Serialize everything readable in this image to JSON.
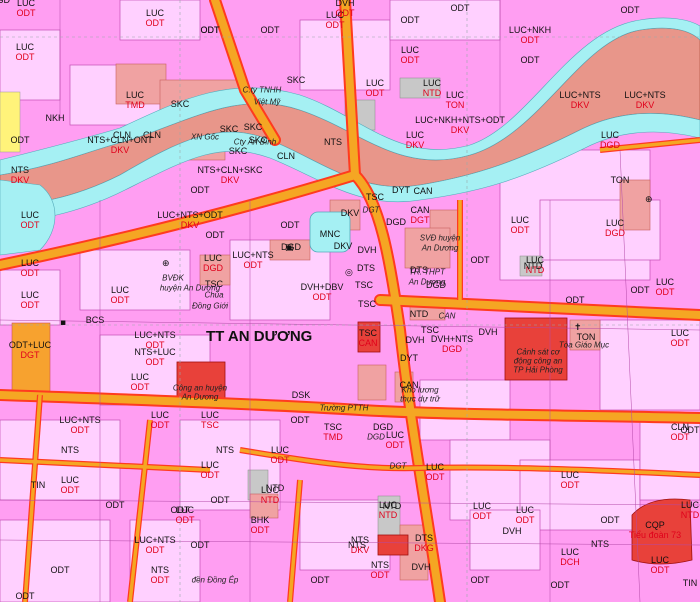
{
  "title": "TT AN DƯƠNG",
  "colors": {
    "residential": "#ff9ef2",
    "agriculture_rice": "#ffd0ff",
    "river": "#e8968a",
    "water": "#a5f0f3",
    "road": "#f5a623",
    "road_edge": "#ff3b1f",
    "public": "#f0a2a2",
    "school": "#f4b39b",
    "police": "#e8413a",
    "yellow": "#fff37a",
    "grey": "#c8c8c8"
  },
  "labels": [
    {
      "code": "LUC",
      "use": "ODT"
    },
    {
      "code": "LUC",
      "use": "ODT"
    },
    {
      "code": "LUC",
      "use": "TMD"
    },
    {
      "code": "ODT",
      "use": ""
    },
    {
      "code": "LUC",
      "use": "ODT"
    },
    {
      "code": "LUC",
      "use": "ODT"
    },
    {
      "code": "DVH",
      "use": "ODT"
    },
    {
      "code": "LUC",
      "use": "ODT"
    },
    {
      "code": "LUC+NKH",
      "use": "ODT"
    },
    {
      "code": "LUC",
      "use": "ODT"
    },
    {
      "code": "LUC",
      "use": "NTD"
    },
    {
      "code": "LUC",
      "use": "TON"
    },
    {
      "code": "LUC+NTS",
      "use": "DKV"
    },
    {
      "code": "LUC+NTS",
      "use": "DKV"
    },
    {
      "code": "LUC+NKH+NTS+ODT",
      "use": "DKV"
    },
    {
      "code": "LUC",
      "use": "DKV"
    },
    {
      "code": "NTS",
      "use": "DKV"
    },
    {
      "code": "NTS+CLN+ONT",
      "use": "DKV"
    },
    {
      "code": "NTS+CLN+SKC",
      "use": "DKV"
    },
    {
      "code": "LUC+NTS+ODT",
      "use": "DKV"
    },
    {
      "code": "LUC",
      "use": "ODT"
    },
    {
      "code": "LUC",
      "use": "ODT"
    },
    {
      "code": "LUC",
      "use": "DGD"
    },
    {
      "code": "LUC+NTS",
      "use": "ODT"
    },
    {
      "code": "DVH+DBV",
      "use": "ODT"
    },
    {
      "code": "LUC",
      "use": "ODT"
    },
    {
      "code": "LUC",
      "use": "ODT"
    },
    {
      "code": "LUC",
      "use": "ODT"
    },
    {
      "code": "LUC",
      "use": "NTD"
    },
    {
      "code": "LUC",
      "use": "DGD"
    },
    {
      "code": "LUC",
      "use": "ODT"
    },
    {
      "code": "LUC",
      "use": "ODT"
    },
    {
      "code": "ODT+LUC",
      "use": "DGT"
    },
    {
      "code": "LUC+NTS",
      "use": "ODT"
    },
    {
      "code": "NTS+LUC",
      "use": "ODT"
    },
    {
      "code": "LUC",
      "use": "ODT"
    },
    {
      "code": "DVH+NTS",
      "use": "DGD"
    },
    {
      "code": "LUC",
      "use": "ODT"
    },
    {
      "code": "LUC+NTS",
      "use": "ODT"
    },
    {
      "code": "LUC",
      "use": "TSC"
    },
    {
      "code": "LUC",
      "use": "ODT"
    },
    {
      "code": "LUC",
      "use": "ODT"
    },
    {
      "code": "LUC",
      "use": "ODT"
    },
    {
      "code": "CLN",
      "use": "ODT"
    },
    {
      "code": "LUC",
      "use": "ODT"
    },
    {
      "code": "LUC",
      "use": "ODT"
    },
    {
      "code": "LUC",
      "use": "ODT"
    },
    {
      "code": "LUC",
      "use": "NTD"
    },
    {
      "code": "LUC",
      "use": "DCH"
    },
    {
      "code": "LUC",
      "use": "ODT"
    },
    {
      "code": "LUC",
      "use": "ODT"
    },
    {
      "code": "LUC+NTS",
      "use": "ODT"
    },
    {
      "code": "NTS",
      "use": "ODT"
    },
    {
      "code": "NTS",
      "use": "ODT"
    },
    {
      "code": "NTS",
      "use": "DKV"
    },
    {
      "code": "LUC",
      "use": "ODT"
    },
    {
      "code": "BHK",
      "use": "ODT"
    },
    {
      "code": "LUC",
      "use": "ODT"
    },
    {
      "code": "TSC",
      "use": "TMD"
    },
    {
      "code": "CQP",
      "use": "Tiểu đoàn 73"
    },
    {
      "code": "CAN",
      "use": "DGT"
    },
    {
      "code": "TSC",
      "use": "CAN"
    },
    {
      "code": "LUC",
      "use": "NTD"
    },
    {
      "code": "LUC",
      "use": "NTD"
    },
    {
      "code": "DTS",
      "use": "DKG"
    },
    {
      "code": "LUC",
      "use": "DGD"
    }
  ],
  "codes": [
    "ODT",
    "ODT",
    "ODT",
    "ODT",
    "ODT",
    "ODT",
    "ODT",
    "ODT",
    "ODT",
    "ODT",
    "ODT",
    "ODT",
    "ODT",
    "ODT",
    "ODT",
    "ODT",
    "ODT",
    "ODT",
    "ODT",
    "ODT",
    "ODT",
    "ODT",
    "ODT",
    "ODT",
    "ODT",
    "NKH",
    "NTS",
    "NTS",
    "NTS",
    "SKC",
    "SKC",
    "SKC",
    "SKC",
    "SKC",
    "SKC",
    "CLN",
    "CLN",
    "CLN",
    "MNC",
    "DKV",
    "DKV",
    "DVH",
    "DTS",
    "DTS",
    "DYT",
    "DYT",
    "TSC",
    "TSC",
    "TSC",
    "TSC",
    "TSC",
    "TON",
    "TON",
    "NTD",
    "NTD",
    "NTD",
    "NTD",
    "DGD",
    "DGD",
    "DGD",
    "DGD",
    "DVH",
    "DVH",
    "CAN",
    "CAN",
    "DSK",
    "BCS",
    "TIN",
    "TIN",
    "DVH",
    "DVH",
    "NTS",
    "NTS",
    "DGD"
  ],
  "notes": [
    "C.ty TNHH",
    "Việt Mỹ",
    "Cty An Bình",
    "XN Gốc",
    "SVĐ huyện",
    "An Dương",
    "TR. THPT",
    "An Dương",
    "BVĐK",
    "huyện An Dương",
    "Chùa",
    "Đồng Giới",
    "Công an huyện",
    "An Dương",
    "Cảnh sát cơ",
    "động công an",
    "TP Hải Phòng",
    "Tòa Giáo Mục",
    "Kho lương",
    "thực dự trữ",
    "Trường PTTH",
    "đền Đồng Ép",
    "DGD",
    "CAN",
    "DGT",
    "DGT"
  ]
}
